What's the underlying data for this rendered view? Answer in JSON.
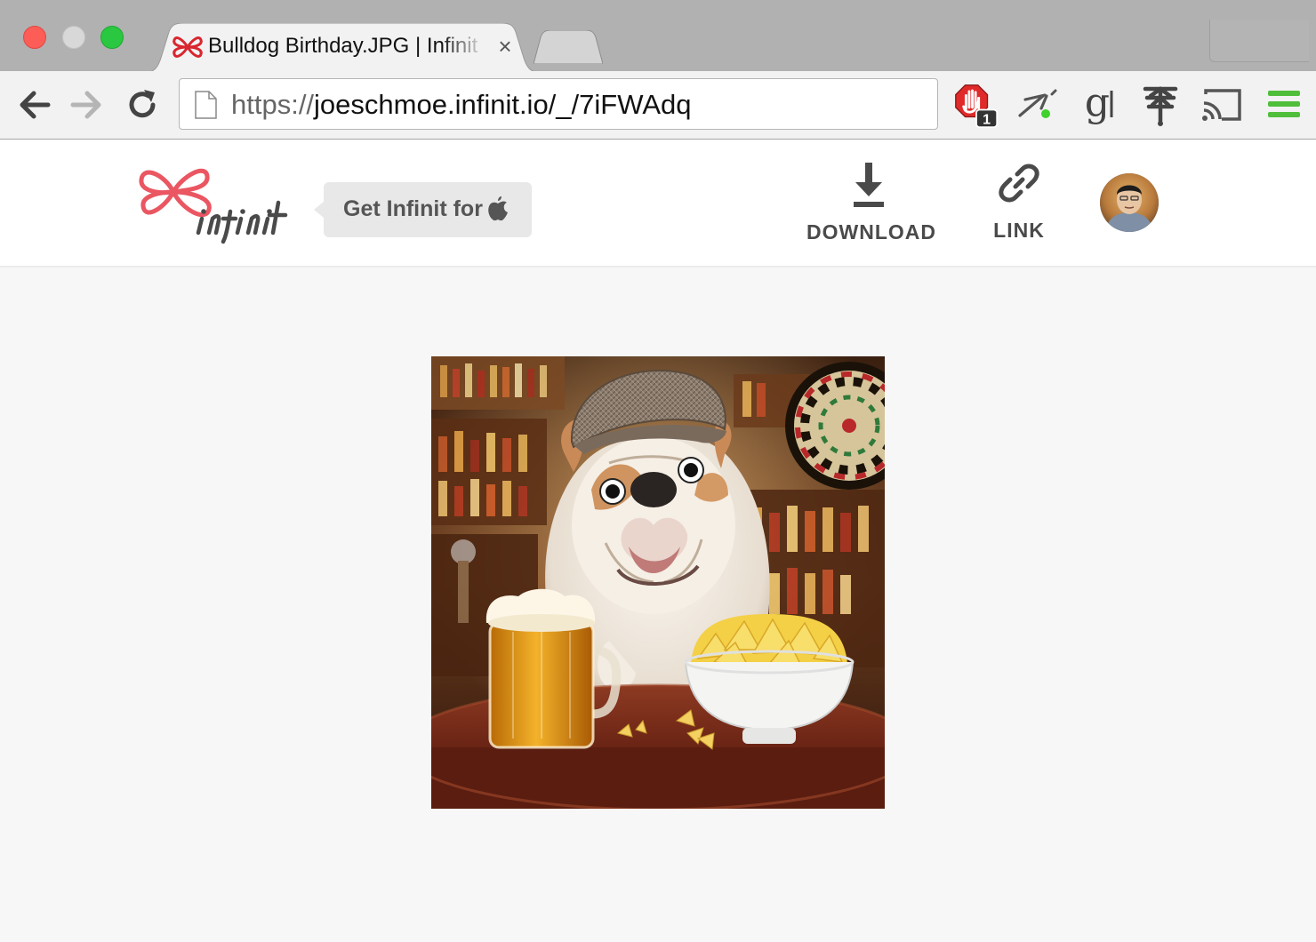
{
  "browser": {
    "tab": {
      "title": "Bulldog Birthday.JPG | Infinit"
    },
    "address_bar": {
      "scheme": "https://",
      "host_path": "joeschmoe.infinit.io/_/7iFWAdq"
    },
    "extensions": [
      {
        "icon": "adblock-hand-icon",
        "badge": "1"
      },
      {
        "icon": "pocket-dash-icon"
      },
      {
        "icon": "google-g-icon",
        "text": "g"
      },
      {
        "icon": "evernote-tree-icon"
      },
      {
        "icon": "cast-icon"
      },
      {
        "icon": "chrome-menu-icon"
      }
    ],
    "colors": {
      "menu_green": "#4fbe3b",
      "adblock_red": "#e02a2a"
    }
  },
  "header": {
    "get_app_label": "Get Infinit for",
    "download_label": "DOWNLOAD",
    "link_label": "LINK",
    "brand_color": "#ea5661"
  },
  "content": {
    "image_subject": "bulldog-in-flat-cap-with-beer-and-chips"
  }
}
